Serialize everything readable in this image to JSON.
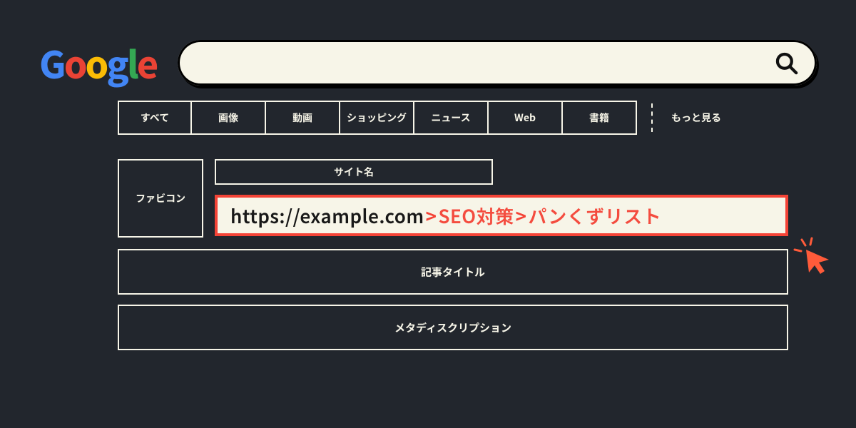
{
  "logo": {
    "g1": "G",
    "o1": "o",
    "o2": "o",
    "g2": "g",
    "l": "l",
    "e": "e"
  },
  "tabs": {
    "all": "すべて",
    "images": "画像",
    "videos": "動画",
    "shopping": "ショッピング",
    "news": "ニュース",
    "web": "Web",
    "books": "書籍",
    "more": "もっと見る"
  },
  "result": {
    "favicon": "ファビコン",
    "sitename": "サイト名",
    "breadcrumb": {
      "url": "https://example.com",
      "sep": ">",
      "seg1": "SEO対策",
      "seg2": "パンくずリスト"
    },
    "article_title": "記事タイトル",
    "meta_description": "メタディスクリプション"
  }
}
